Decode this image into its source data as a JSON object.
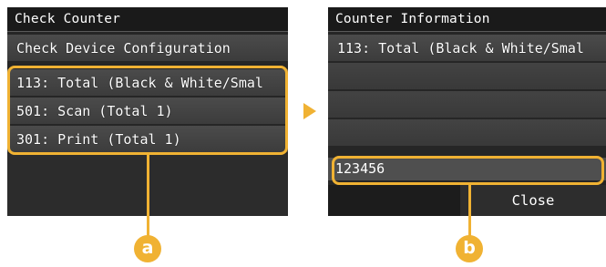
{
  "left_screen": {
    "title": "Check Counter",
    "items": [
      {
        "label": "Check Device Configuration"
      },
      {
        "label": "113: Total (Black & White/Smal"
      },
      {
        "label": "501: Scan (Total 1)"
      },
      {
        "label": "301: Print (Total 1)"
      }
    ]
  },
  "right_screen": {
    "title": "Counter Information",
    "items": [
      {
        "label": "113: Total (Black & White/Smal"
      }
    ],
    "counter_value": "123456",
    "close_label": "Close"
  },
  "callouts": {
    "a": "a",
    "b": "b",
    "accent_color": "#f0b233"
  }
}
